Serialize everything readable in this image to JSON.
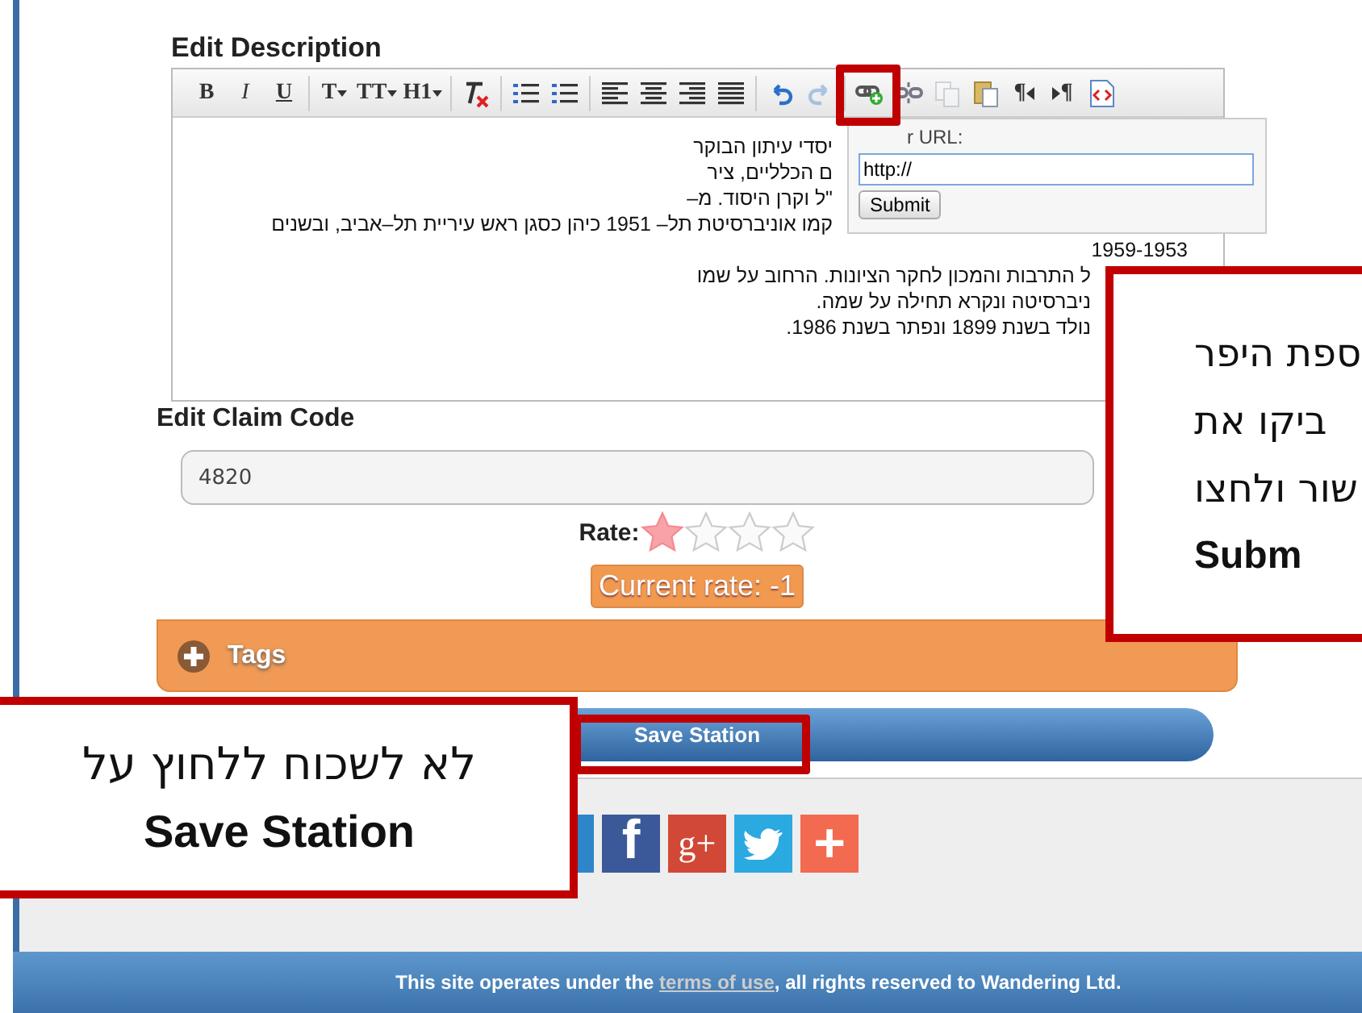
{
  "editor": {
    "title": "Edit Description",
    "toolbar": [
      [
        {
          "kind": "source",
          "disabled": false
        },
        {
          "kind": "ltr",
          "label": "¶",
          "disabled": false
        },
        {
          "kind": "rtl",
          "label": "¶",
          "disabled": false
        },
        {
          "kind": "paste",
          "disabled": false
        },
        {
          "kind": "copy",
          "disabled": true
        },
        {
          "kind": "unlink",
          "disabled": false
        },
        {
          "kind": "link",
          "disabled": false
        }
      ],
      [
        {
          "kind": "redo",
          "disabled": true
        },
        {
          "kind": "undo",
          "disabled": false
        }
      ],
      [
        {
          "kind": "justify",
          "disabled": false
        },
        {
          "kind": "align-right",
          "disabled": false
        },
        {
          "kind": "align-center",
          "disabled": false
        },
        {
          "kind": "align-left",
          "disabled": false
        }
      ],
      [
        {
          "kind": "numbers",
          "disabled": false
        },
        {
          "kind": "bullets",
          "disabled": false
        }
      ],
      [
        {
          "kind": "clear",
          "disabled": false
        }
      ],
      [
        {
          "kind": "heading",
          "label": "H1",
          "disabled": false
        },
        {
          "kind": "size",
          "label": "TT",
          "disabled": false
        },
        {
          "kind": "font",
          "label": "T",
          "disabled": false
        }
      ],
      [
        {
          "kind": "underline",
          "label": "U",
          "disabled": false
        },
        {
          "kind": "italic",
          "label": "I",
          "disabled": false
        },
        {
          "kind": "bold",
          "label": "B",
          "disabled": false
        }
      ]
    ],
    "lines": [
      {
        "text": "יסדי עיתון הבוקר",
        "kind": "under_popup"
      },
      {
        "text": "ם הכלליים, ציר",
        "kind": "under_popup"
      },
      {
        "text": "\"ל וקרן היסוד. מ–",
        "kind": "under_popup"
      },
      {
        "text": "קמו אוניברסיטת תל– 1951 כיהן כסגן ראש עיריית תל–אביב, ובשנים",
        "kind": "under_popup"
      },
      {
        "text": "1959-1953",
        "kind": "full"
      },
      {
        "text": "ל התרבות והמכון לחקר הציונות. הרחוב על שמו",
        "kind": "under_callout"
      },
      {
        "text": "ניברסיטה ונקרא תחילה על שמה.",
        "kind": "under_callout"
      },
      {
        "text": "נולד בשנת 1899 ונפתר בשנת 1986.",
        "kind": "under_callout"
      }
    ]
  },
  "link_popup": {
    "label": "r URL:",
    "value": "http://",
    "button": "Submit"
  },
  "claim": {
    "label": "Edit Claim Code",
    "value": "4820"
  },
  "rating": {
    "label": "Rate:",
    "stars": 1,
    "current": "Current rate: -1"
  },
  "tags": {
    "label": "Tags",
    "expanded": false
  },
  "save_button": "Save Station",
  "social": [
    {
      "kind": "more",
      "text": "+"
    },
    {
      "kind": "twitter"
    },
    {
      "kind": "googleplus",
      "text": "g+"
    },
    {
      "kind": "facebook",
      "text": "f"
    },
    {
      "kind": "partial"
    }
  ],
  "footer": {
    "before": "This site operates under the ",
    "link": "terms of use",
    "after": ", all rights reserved to Wandering Ltd."
  },
  "callouts": [
    {
      "kind": "right",
      "lines": [
        {
          "text": "ספת היפר",
          "bold": false
        },
        {
          "text": "ביקו את",
          "bold": false
        },
        {
          "text": "שור ולחצו",
          "bold": false
        },
        {
          "text": "Subm",
          "bold": true
        }
      ]
    },
    {
      "kind": "left",
      "lines": [
        {
          "text": "לא לשכוח ללחוץ על",
          "bold": false
        },
        {
          "text": "Save Station",
          "bold": true
        }
      ]
    }
  ]
}
